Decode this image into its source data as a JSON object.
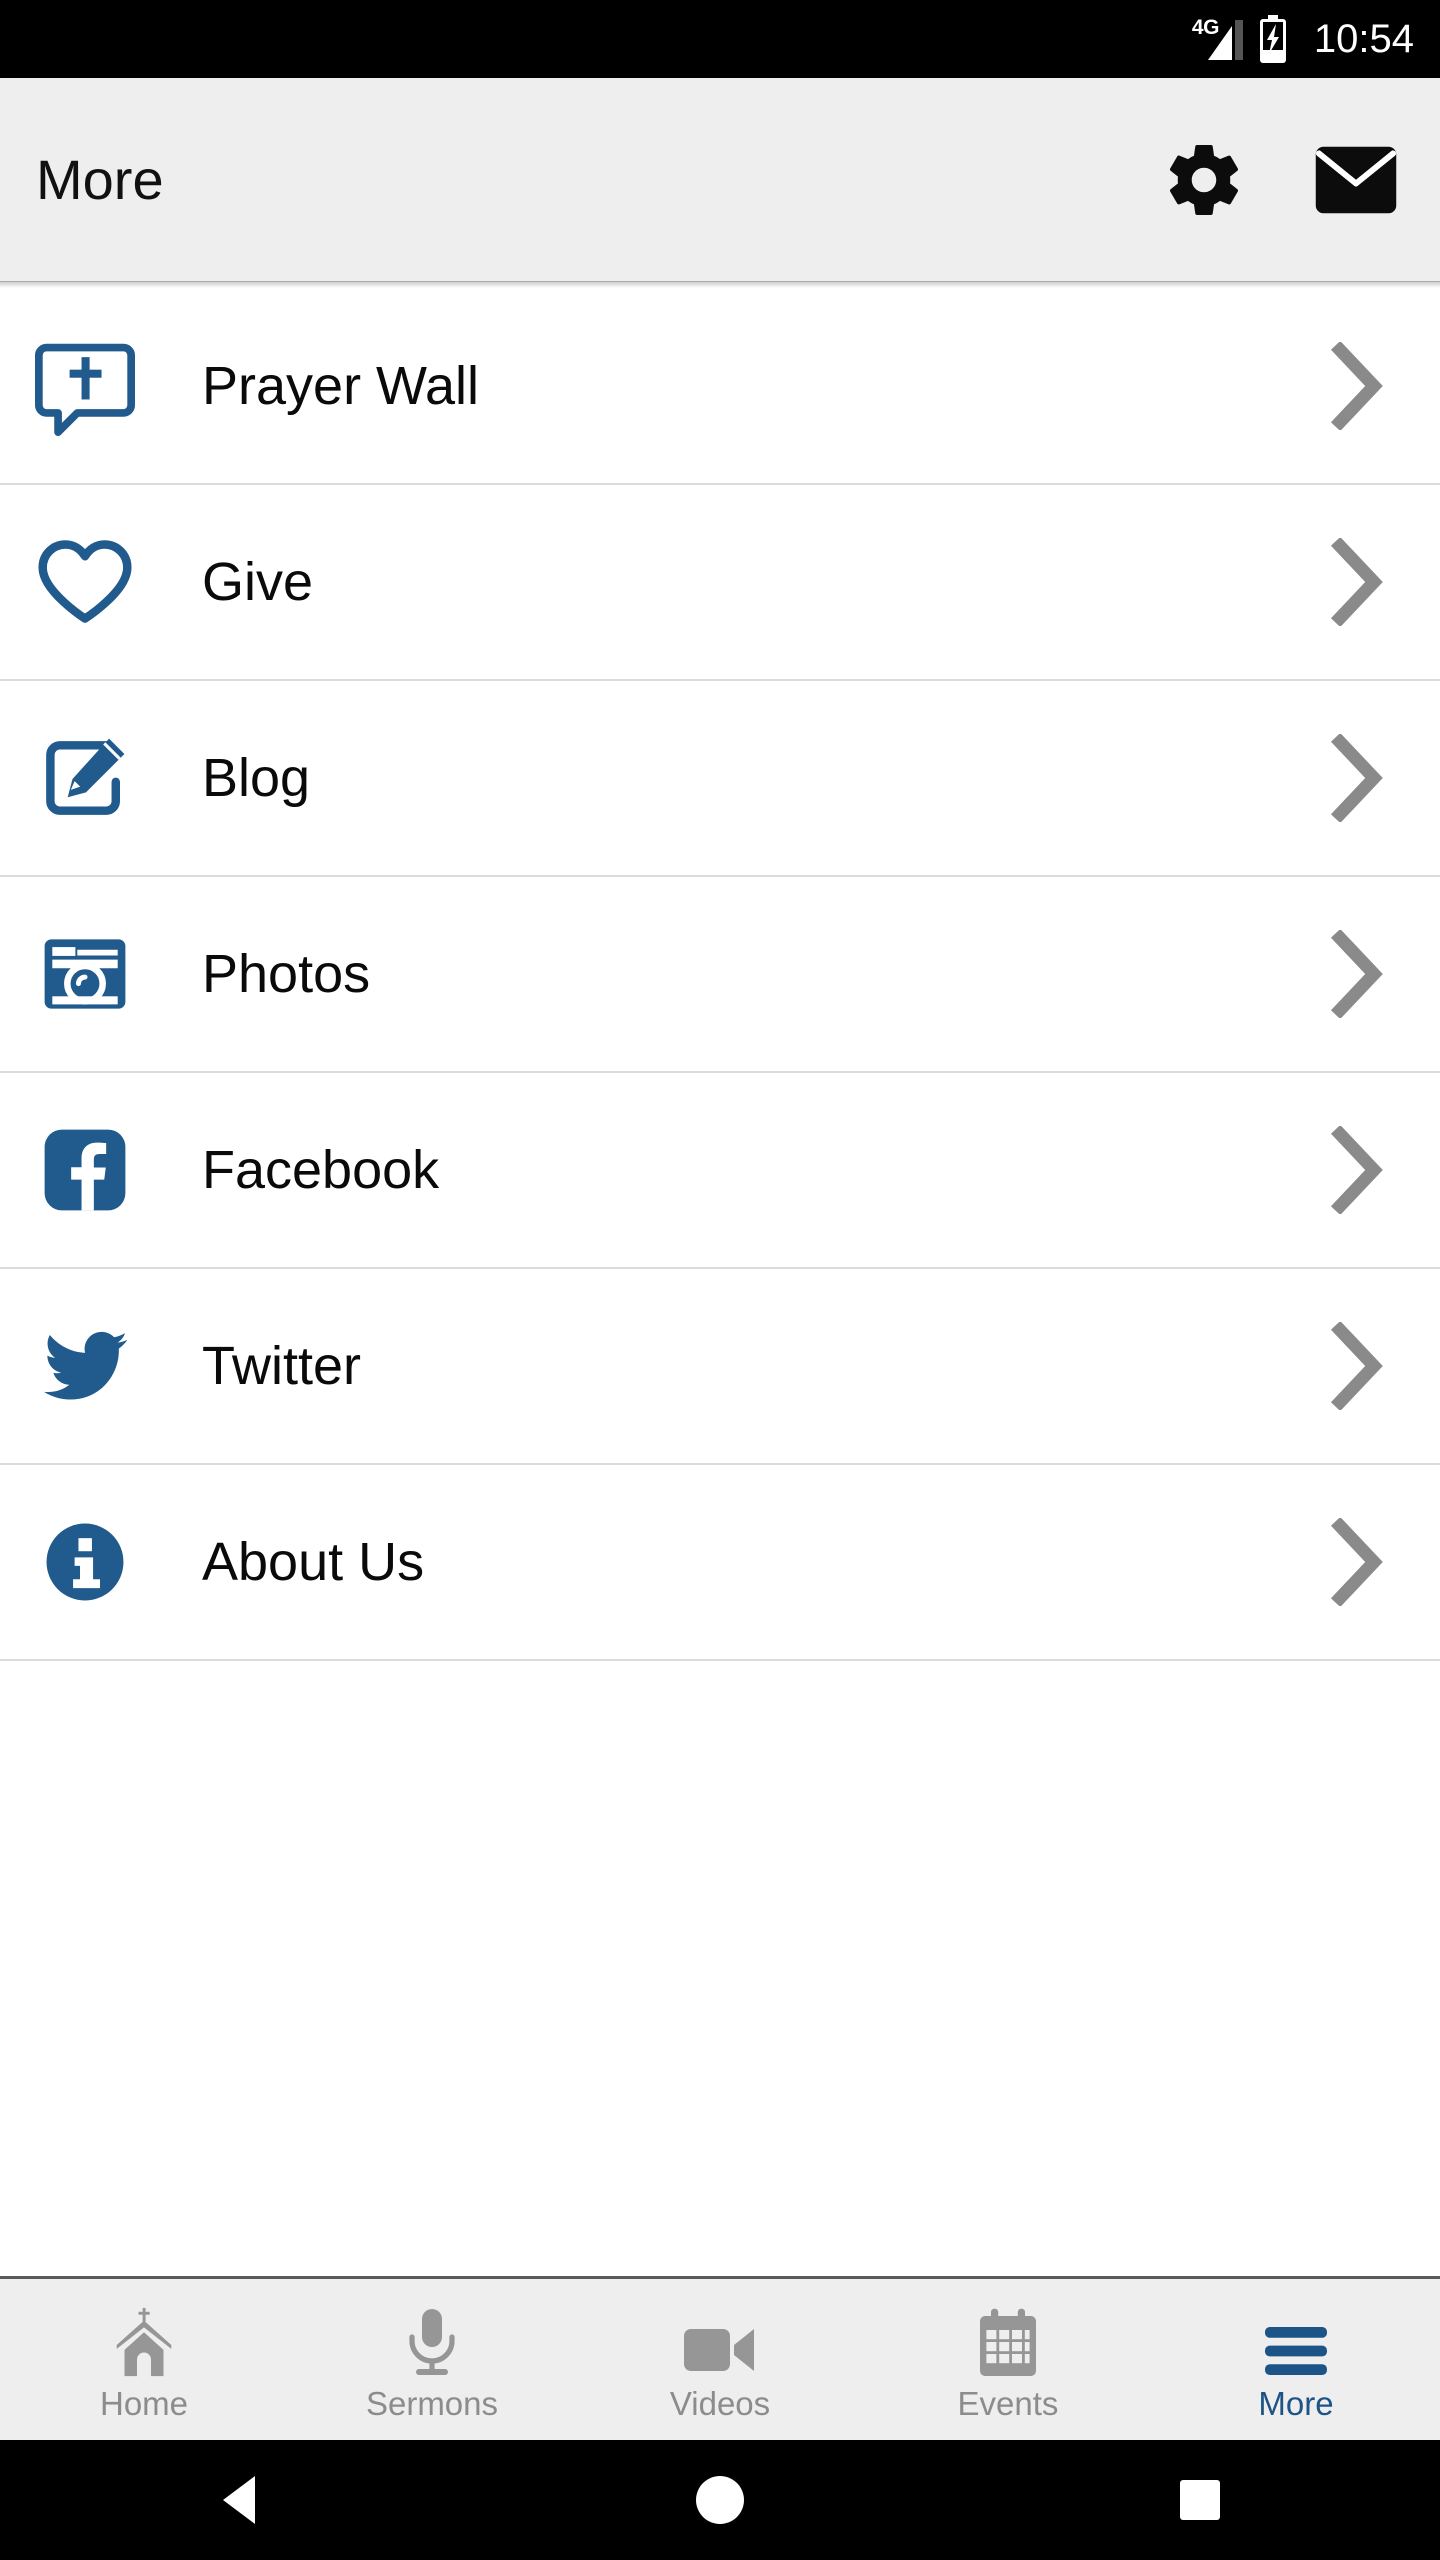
{
  "status_bar": {
    "network": "4G",
    "battery_icon": "battery-charging-icon",
    "signal_icon": "signal-bars-icon",
    "time": "10:54"
  },
  "header": {
    "title": "More",
    "actions": [
      {
        "name": "settings-button",
        "icon": "gear-icon"
      },
      {
        "name": "mail-button",
        "icon": "envelope-icon"
      }
    ]
  },
  "colors": {
    "brand_blue": "#1d5488",
    "icon_blue": "#215a8c",
    "chevron_gray": "#8a8a8a",
    "tab_inactive": "#8c8c8c",
    "header_bg": "#eeeeee",
    "divider": "#dcdcdc"
  },
  "list": {
    "items": [
      {
        "label": "Prayer Wall",
        "icon": "prayer-bubble-cross-icon",
        "chevron": "chevron-right-icon"
      },
      {
        "label": "Give",
        "icon": "heart-icon",
        "chevron": "chevron-right-icon"
      },
      {
        "label": "Blog",
        "icon": "pencil-edit-square-icon",
        "chevron": "chevron-right-icon"
      },
      {
        "label": "Photos",
        "icon": "camera-icon",
        "chevron": "chevron-right-icon"
      },
      {
        "label": "Facebook",
        "icon": "facebook-icon",
        "chevron": "chevron-right-icon"
      },
      {
        "label": "Twitter",
        "icon": "twitter-bird-icon",
        "chevron": "chevron-right-icon"
      },
      {
        "label": "About Us",
        "icon": "info-circle-icon",
        "chevron": "chevron-right-icon"
      }
    ]
  },
  "tabbar": {
    "items": [
      {
        "label": "Home",
        "icon": "church-icon",
        "active": false
      },
      {
        "label": "Sermons",
        "icon": "microphone-icon",
        "active": false
      },
      {
        "label": "Videos",
        "icon": "video-camera-icon",
        "active": false
      },
      {
        "label": "Events",
        "icon": "calendar-icon",
        "active": false
      },
      {
        "label": "More",
        "icon": "hamburger-menu-icon",
        "active": true
      }
    ]
  },
  "navbar": {
    "back": "back-triangle-icon",
    "home": "home-circle-icon",
    "recents": "recents-square-icon"
  }
}
